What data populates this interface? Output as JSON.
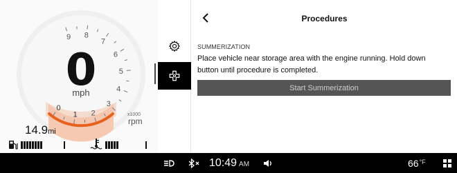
{
  "gauge": {
    "speed_value": "0",
    "speed_unit": "mph",
    "rpm_multiplier": "x1000",
    "rpm_unit": "rpm",
    "rpm_value": 0,
    "tach_labels": [
      "9",
      "8",
      "7",
      "6",
      "5",
      "4",
      "3",
      "2",
      "1",
      "0"
    ],
    "odometer_value": "14.9",
    "odometer_unit": "mi",
    "fuel_level_segments": 8,
    "coolant_level_segments": 5,
    "accent_color": "#e8611c",
    "idle_zone_color": "#f5c9b2"
  },
  "menu": {
    "items": [
      {
        "name": "settings",
        "icon": "gear-icon",
        "active": false
      },
      {
        "name": "procedures",
        "icon": "tool-icon",
        "active": true
      }
    ]
  },
  "main": {
    "title": "Procedures",
    "section_label": "SUMMERIZATION",
    "instructions": "Place vehicle near storage area with the engine running. Hold down button until procedure is completed.",
    "action_label": "Start Summerization"
  },
  "status_bar": {
    "time": "10:49",
    "ampm": "AM",
    "temperature": "66",
    "temperature_unit": "°F",
    "icons": [
      "highbeam-off-icon",
      "bluetooth-disconnected-icon",
      "volume-icon",
      "grid-menu-icon"
    ]
  }
}
